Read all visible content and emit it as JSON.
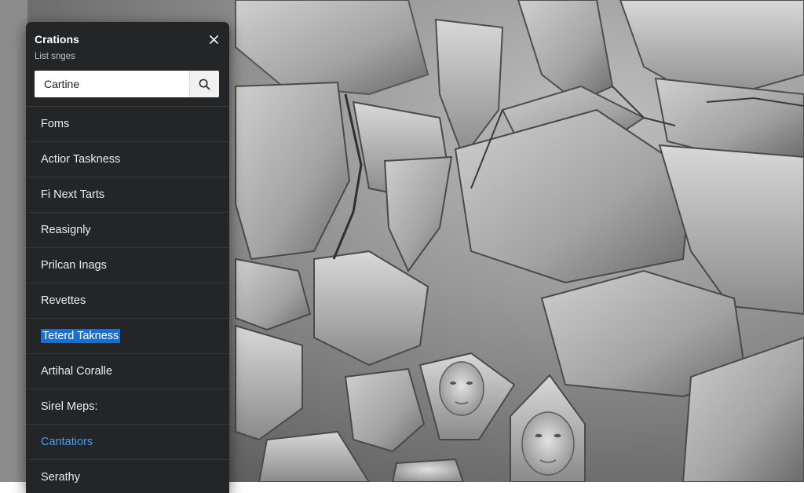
{
  "panel": {
    "title": "Crations",
    "subtitle": "List snges",
    "search": {
      "value": "Cartine",
      "placeholder": ""
    },
    "items": [
      {
        "label": "Foms"
      },
      {
        "label": "Actior Taskness"
      },
      {
        "label": "Fi Next Tarts"
      },
      {
        "label": "Reasignly"
      },
      {
        "label": "Prilcan Inags"
      },
      {
        "label": "Revettes"
      },
      {
        "label": "Teterd Takness",
        "state": "selected"
      },
      {
        "label": "Artihal Coralle"
      },
      {
        "label": "Sirel Meps:"
      },
      {
        "label": "Cantatiors",
        "state": "accent"
      },
      {
        "label": "Serathy"
      }
    ]
  },
  "icons": {
    "close": "close-icon",
    "search": "search-icon"
  },
  "colors": {
    "panel_bg": "#242526",
    "highlight": "#1c6fd1",
    "accent": "#3ea0ff"
  }
}
